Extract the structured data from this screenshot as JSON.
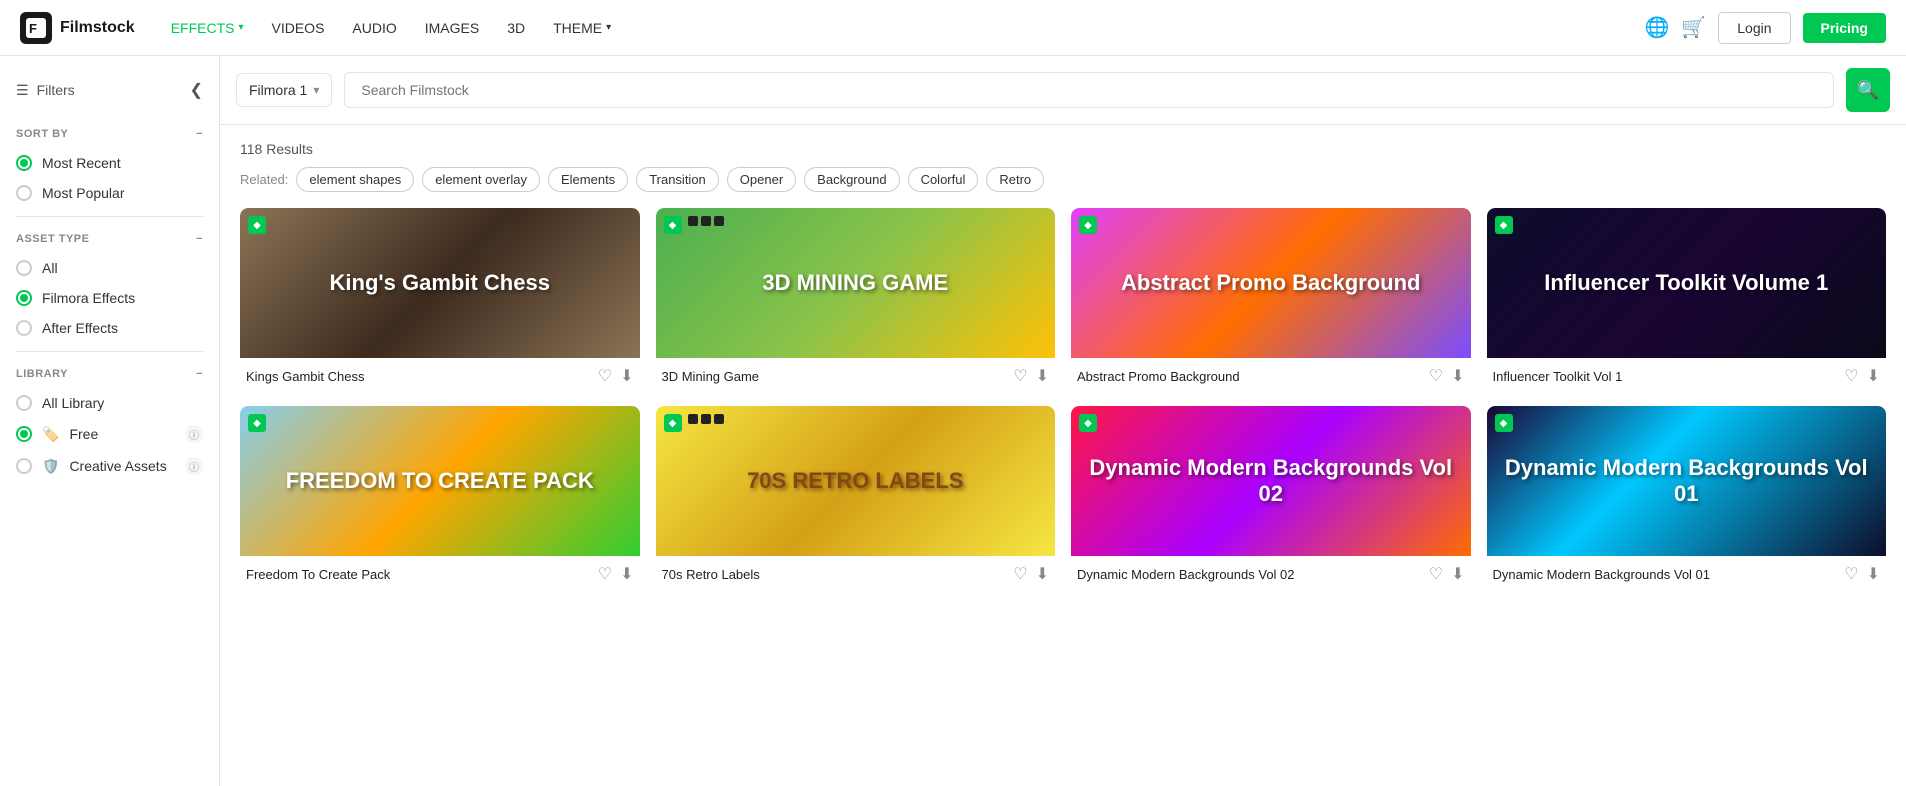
{
  "navbar": {
    "logo_icon": "F",
    "logo_text": "Filmstock",
    "nav_items": [
      {
        "label": "EFFECTS",
        "active": true,
        "has_chevron": true
      },
      {
        "label": "VIDEOS",
        "active": false,
        "has_chevron": false
      },
      {
        "label": "AUDIO",
        "active": false,
        "has_chevron": false
      },
      {
        "label": "IMAGES",
        "active": false,
        "has_chevron": false
      },
      {
        "label": "3D",
        "active": false,
        "has_chevron": false
      },
      {
        "label": "THEME",
        "active": false,
        "has_chevron": true
      }
    ],
    "login_label": "Login",
    "pricing_label": "Pricing"
  },
  "sidebar": {
    "filters_label": "Filters",
    "sort_by_label": "SORT BY",
    "sort_options": [
      {
        "label": "Most Recent",
        "checked": true
      },
      {
        "label": "Most Popular",
        "checked": false
      }
    ],
    "asset_type_label": "ASSET TYPE",
    "asset_options": [
      {
        "label": "All",
        "checked": false
      },
      {
        "label": "Filmora Effects",
        "checked": true
      },
      {
        "label": "After Effects",
        "checked": false
      }
    ],
    "library_label": "LIBRARY",
    "library_options": [
      {
        "label": "All Library",
        "checked": false,
        "has_badge": false
      },
      {
        "label": "Free",
        "checked": true,
        "has_badge": true,
        "icon": "🏷️"
      },
      {
        "label": "Creative Assets",
        "checked": false,
        "has_badge": true,
        "icon": "🛡️"
      }
    ]
  },
  "search": {
    "selector_label": "Filmora 1",
    "placeholder": "Search Filmstock"
  },
  "content": {
    "results_count": "118 Results",
    "related_label": "Related:",
    "tags": [
      "element shapes",
      "element overlay",
      "Elements",
      "Transition",
      "Opener",
      "Background",
      "Colorful",
      "Retro"
    ],
    "cards": [
      {
        "title": "Kings Gambit Chess",
        "thumb_class": "thumb-chess",
        "thumb_text": "King's Gambit Chess",
        "has_dots": false
      },
      {
        "title": "3D Mining Game",
        "thumb_class": "thumb-mining",
        "thumb_text": "3D MINING GAME",
        "has_dots": true
      },
      {
        "title": "Abstract Promo Background",
        "thumb_class": "thumb-abstract",
        "thumb_text": "Abstract Promo Background",
        "has_dots": false
      },
      {
        "title": "Influencer Toolkit Vol 1",
        "thumb_class": "thumb-influencer",
        "thumb_text": "Influencer Toolkit Volume 1",
        "has_dots": false
      },
      {
        "title": "Freedom To Create Pack",
        "thumb_class": "thumb-freedom",
        "thumb_text": "FREEDOM TO CREATE PACK",
        "has_dots": false
      },
      {
        "title": "70s Retro Labels",
        "thumb_class": "thumb-retro",
        "thumb_text": "70S RETRO LABELS",
        "has_dots": true
      },
      {
        "title": "Dynamic Modern Backgrounds Vol 02",
        "thumb_class": "thumb-dynamic2",
        "thumb_text": "Dynamic Modern Backgrounds Vol 02",
        "has_dots": false
      },
      {
        "title": "Dynamic Modern Backgrounds Vol 01",
        "thumb_class": "thumb-dynamic1",
        "thumb_text": "Dynamic Modern Backgrounds Vol 01",
        "has_dots": false
      }
    ]
  },
  "icons": {
    "search": "🔍",
    "globe": "🌐",
    "cart": "🛒",
    "heart": "♡",
    "download": "⬇",
    "collapse": "❮",
    "minus": "−",
    "diamond": "◆"
  }
}
